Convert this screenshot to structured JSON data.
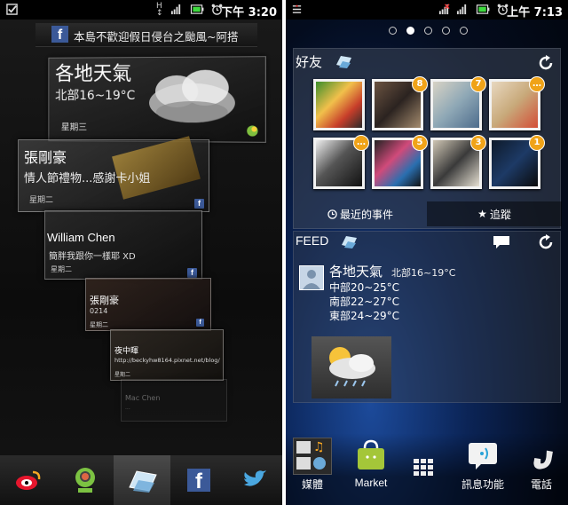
{
  "left": {
    "status": {
      "time": "下午 3:20"
    },
    "notification": {
      "text": "本島不歡迎假日侵台之颱風~阿搭"
    },
    "weather_card": {
      "title": "各地天氣",
      "subtitle": "北部16~19°C",
      "day": "星期三"
    },
    "cards": [
      {
        "title": "張剛豪",
        "text": "情人節禮物...感謝卡小姐",
        "day": "星期二"
      },
      {
        "title": "William Chen",
        "text": "簡胖我跟你一樣耶 XD",
        "day": "星期二"
      },
      {
        "title": "張剛豪",
        "text": "0214",
        "day": "星期二"
      },
      {
        "title": "夜中暉",
        "text": "http://beckyhw8164.pixnet.net/blog/",
        "day": "星期二"
      },
      {
        "title": "Mac Chen",
        "text": "...",
        "day": ""
      }
    ],
    "dock": [
      "weibo-icon",
      "frog-app-icon",
      "timescape-icon",
      "facebook-icon",
      "twitter-icon"
    ]
  },
  "right": {
    "status": {
      "time": "上午 7:13"
    },
    "friends": {
      "title": "好友",
      "badges": [
        "",
        "8",
        "7",
        "…",
        "…",
        "5",
        "3",
        "1"
      ],
      "tab_recent": "最近的事件",
      "tab_follow": "追蹤"
    },
    "feed": {
      "title": "FEED",
      "item_title": "各地天氣",
      "item_sub": "北部16~19°C",
      "lines": [
        "中部20~25°C",
        "南部22~27°C",
        "東部24~29°C"
      ]
    },
    "dock": {
      "media": "媒體",
      "market": "Market",
      "messaging": "訊息功能",
      "phone": "電話"
    },
    "colors": {
      "badge": "#f0a318",
      "accent": "#1c4a9a"
    }
  }
}
